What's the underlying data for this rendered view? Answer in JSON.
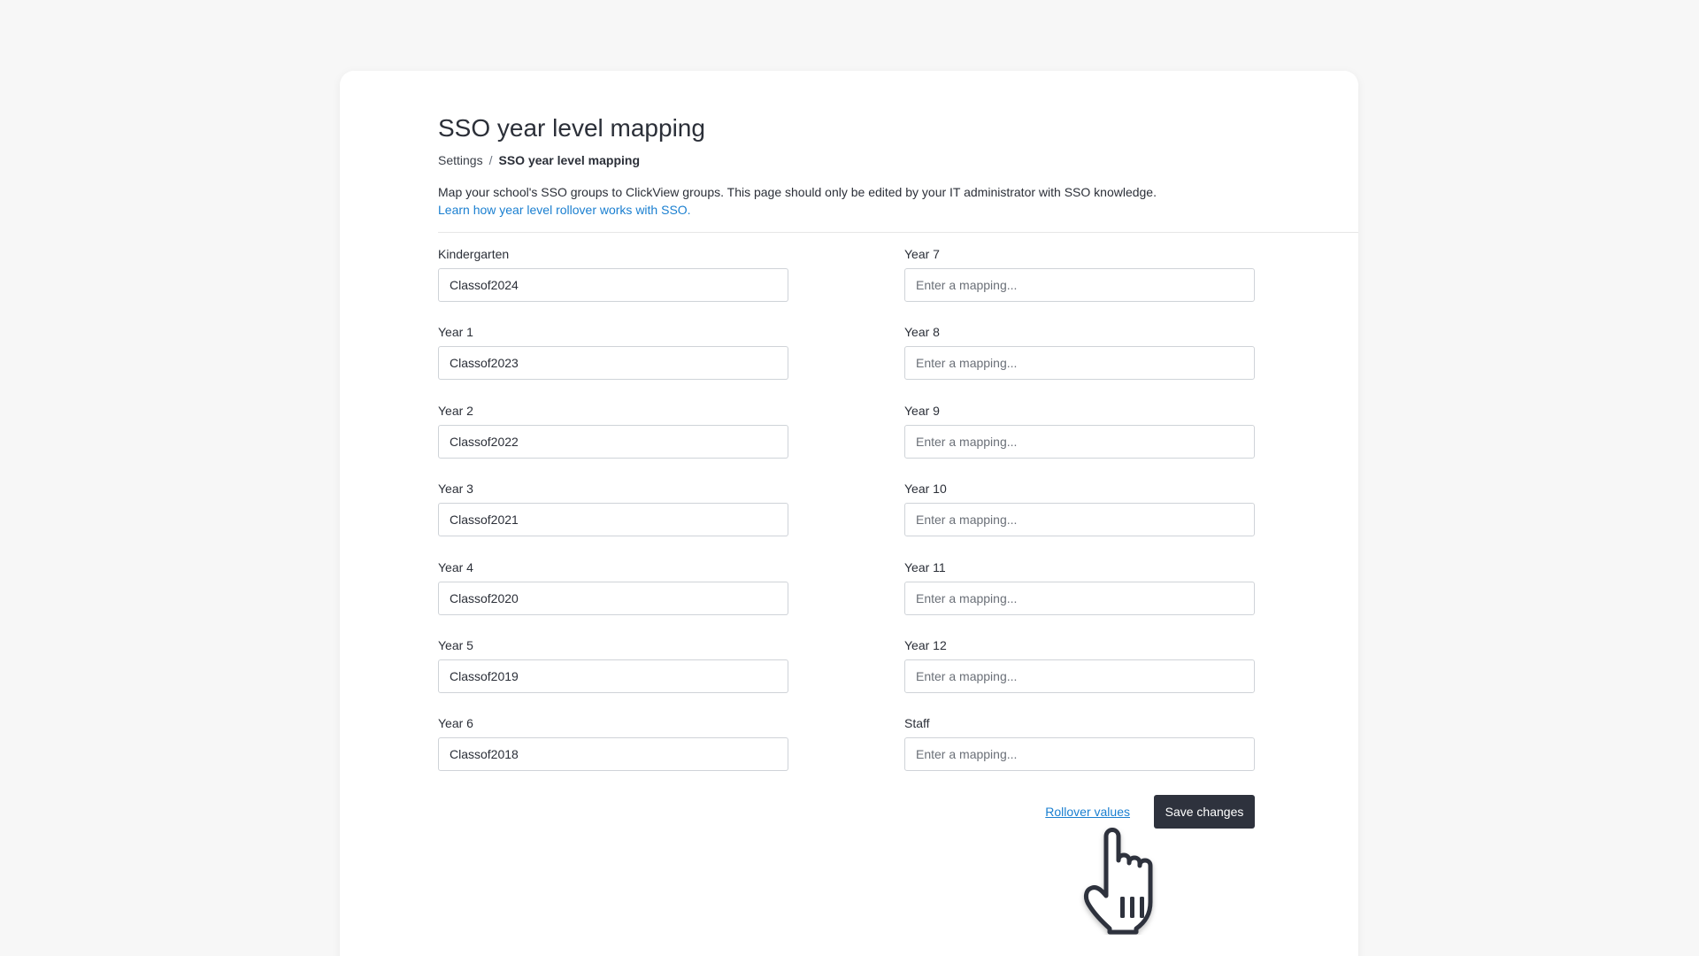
{
  "header": {
    "title": "SSO year level mapping",
    "breadcrumb": {
      "parent": "Settings",
      "separator": "/",
      "current": "SSO year level mapping"
    },
    "description": "Map your school's SSO groups to ClickView groups. This page should only be edited by your IT administrator with SSO knowledge.",
    "learn_link": "Learn how year level rollover works with SSO."
  },
  "fields_left": [
    {
      "label": "Kindergarten",
      "value": "Classof2024",
      "placeholder": ""
    },
    {
      "label": "Year 1",
      "value": "Classof2023",
      "placeholder": ""
    },
    {
      "label": "Year 2",
      "value": "Classof2022",
      "placeholder": ""
    },
    {
      "label": "Year 3",
      "value": "Classof2021",
      "placeholder": ""
    },
    {
      "label": "Year 4",
      "value": "Classof2020",
      "placeholder": ""
    },
    {
      "label": "Year 5",
      "value": "Classof2019",
      "placeholder": ""
    },
    {
      "label": "Year 6",
      "value": "Classof2018",
      "placeholder": ""
    }
  ],
  "fields_right": [
    {
      "label": "Year 7",
      "value": "",
      "placeholder": "Enter a mapping..."
    },
    {
      "label": "Year 8",
      "value": "",
      "placeholder": "Enter a mapping..."
    },
    {
      "label": "Year 9",
      "value": "",
      "placeholder": "Enter a mapping..."
    },
    {
      "label": "Year 10",
      "value": "",
      "placeholder": "Enter a mapping..."
    },
    {
      "label": "Year 11",
      "value": "",
      "placeholder": "Enter a mapping..."
    },
    {
      "label": "Year 12",
      "value": "",
      "placeholder": "Enter a mapping..."
    },
    {
      "label": "Staff",
      "value": "",
      "placeholder": "Enter a mapping..."
    }
  ],
  "actions": {
    "rollover_label": "Rollover values",
    "save_label": "Save changes"
  },
  "colors": {
    "background": "#f7f7f7",
    "link": "#1a7fd0",
    "primary_button": "#2e323d",
    "text": "#2b2f38"
  },
  "icons": {
    "cursor": "hand-pointer-icon"
  }
}
